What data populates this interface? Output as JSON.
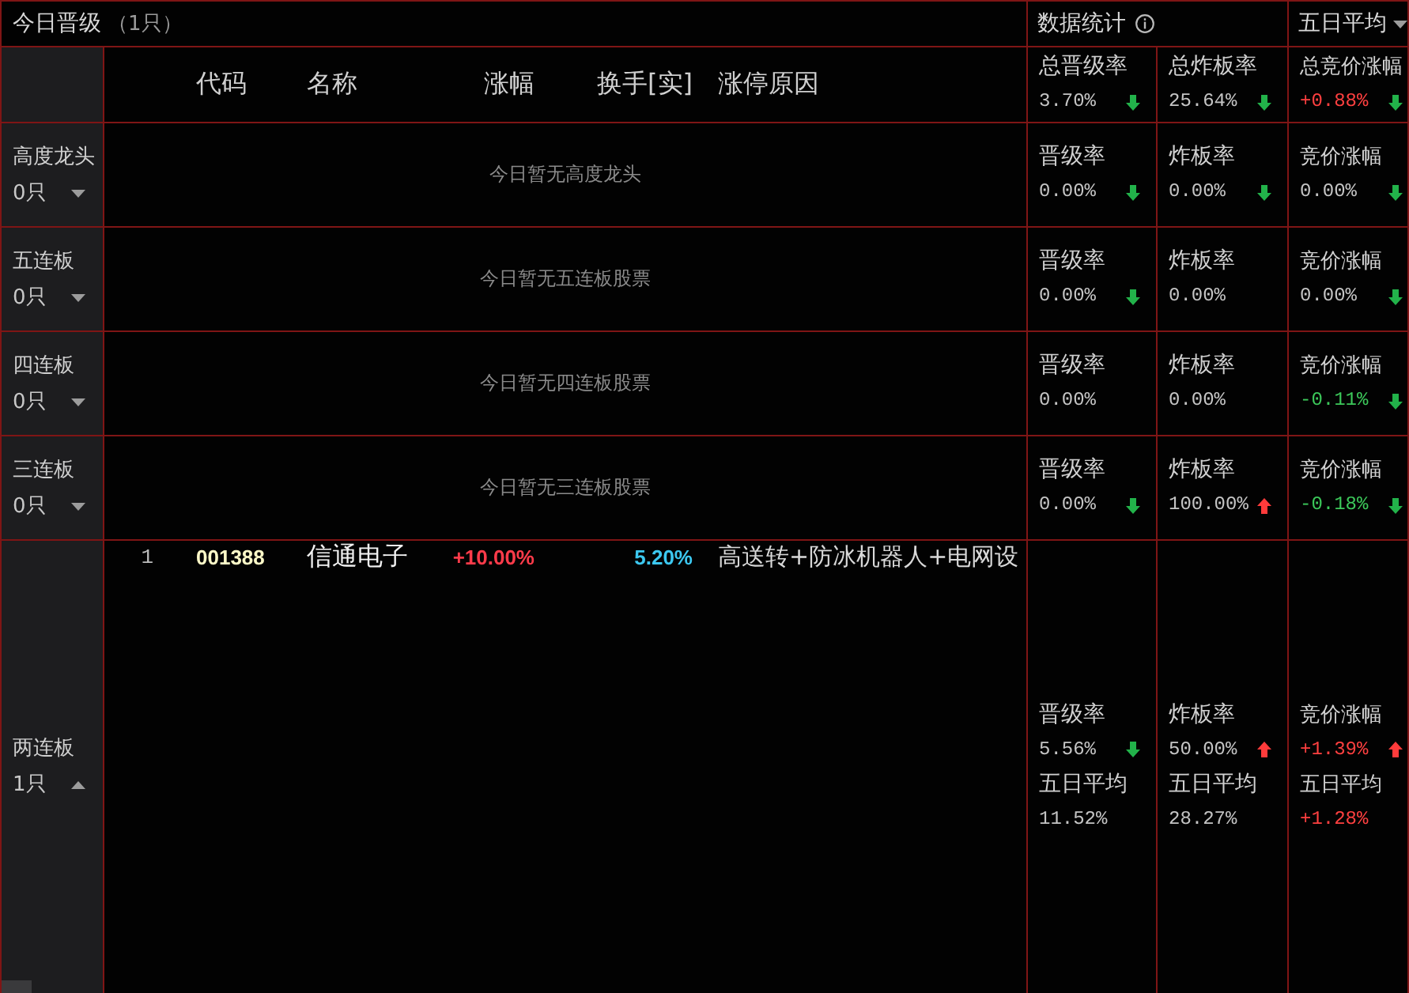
{
  "header": {
    "title": "今日晋级",
    "count": "（1只）"
  },
  "stats_header": {
    "title": "数据统计"
  },
  "period_selector": {
    "label": "五日平均"
  },
  "columns": [
    "代码",
    "名称",
    "涨幅",
    "换手[实]",
    "涨停原因"
  ],
  "summary": [
    {
      "label": "总晋级率",
      "value": "3.70%",
      "rise": false,
      "fall": false,
      "arrow_up": false,
      "arrow_down": true
    },
    {
      "label": "总炸板率",
      "value": "25.64%",
      "rise": false,
      "fall": false,
      "arrow_up": false,
      "arrow_down": true
    },
    {
      "label": "总竞价涨幅",
      "value": "+0.88%",
      "rise": true,
      "fall": false,
      "arrow_up": false,
      "arrow_down": true
    }
  ],
  "tiers": [
    {
      "name": "高度龙头",
      "count": "0只",
      "expanded": false,
      "empty_text": "今日暂无高度龙头",
      "stats": [
        {
          "label": "晋级率",
          "value": "0.00%",
          "rise": false,
          "fall": false,
          "arrow_up": false,
          "arrow_down": true
        },
        {
          "label": "炸板率",
          "value": "0.00%",
          "rise": false,
          "fall": false,
          "arrow_up": false,
          "arrow_down": true
        },
        {
          "label": "竞价涨幅",
          "value": "0.00%",
          "rise": false,
          "fall": false,
          "arrow_up": false,
          "arrow_down": true
        }
      ]
    },
    {
      "name": "五连板",
      "count": "0只",
      "expanded": false,
      "empty_text": "今日暂无五连板股票",
      "stats": [
        {
          "label": "晋级率",
          "value": "0.00%",
          "rise": false,
          "fall": false,
          "arrow_up": false,
          "arrow_down": true
        },
        {
          "label": "炸板率",
          "value": "0.00%",
          "rise": false,
          "fall": false,
          "arrow_up": false,
          "arrow_down": false
        },
        {
          "label": "竞价涨幅",
          "value": "0.00%",
          "rise": false,
          "fall": false,
          "arrow_up": false,
          "arrow_down": true
        }
      ]
    },
    {
      "name": "四连板",
      "count": "0只",
      "expanded": false,
      "empty_text": "今日暂无四连板股票",
      "stats": [
        {
          "label": "晋级率",
          "value": "0.00%",
          "rise": false,
          "fall": false,
          "arrow_up": false,
          "arrow_down": false
        },
        {
          "label": "炸板率",
          "value": "0.00%",
          "rise": false,
          "fall": false,
          "arrow_up": false,
          "arrow_down": false
        },
        {
          "label": "竞价涨幅",
          "value": "-0.11%",
          "rise": false,
          "fall": true,
          "arrow_up": false,
          "arrow_down": true
        }
      ]
    },
    {
      "name": "三连板",
      "count": "0只",
      "expanded": false,
      "empty_text": "今日暂无三连板股票",
      "stats": [
        {
          "label": "晋级率",
          "value": "0.00%",
          "rise": false,
          "fall": false,
          "arrow_up": false,
          "arrow_down": true
        },
        {
          "label": "炸板率",
          "value": "100.00%",
          "rise": false,
          "fall": false,
          "arrow_up": true,
          "arrow_down": false
        },
        {
          "label": "竞价涨幅",
          "value": "-0.18%",
          "rise": false,
          "fall": true,
          "arrow_up": false,
          "arrow_down": true
        }
      ]
    },
    {
      "name": "两连板",
      "count": "1只",
      "expanded": true,
      "stocks": [
        {
          "index": "1",
          "code": "001388",
          "name": "信通电子",
          "change": "+10.00%",
          "turnover": "5.20%",
          "reason": "高送转+防冰机器人+电网设"
        }
      ],
      "stats": [
        {
          "label": "晋级率",
          "value": "5.56%",
          "rise": false,
          "fall": false,
          "arrow_up": false,
          "arrow_down": true,
          "average": {
            "label": "五日平均",
            "value": "11.52%",
            "rise": false,
            "fall": false
          }
        },
        {
          "label": "炸板率",
          "value": "50.00%",
          "rise": false,
          "fall": false,
          "arrow_up": true,
          "arrow_down": false,
          "average": {
            "label": "五日平均",
            "value": "28.27%",
            "rise": false,
            "fall": false
          }
        },
        {
          "label": "竞价涨幅",
          "value": "+1.39%",
          "rise": true,
          "fall": false,
          "arrow_up": true,
          "arrow_down": false,
          "average": {
            "label": "五日平均",
            "value": "+1.28%",
            "rise": true,
            "fall": false
          }
        }
      ]
    }
  ]
}
